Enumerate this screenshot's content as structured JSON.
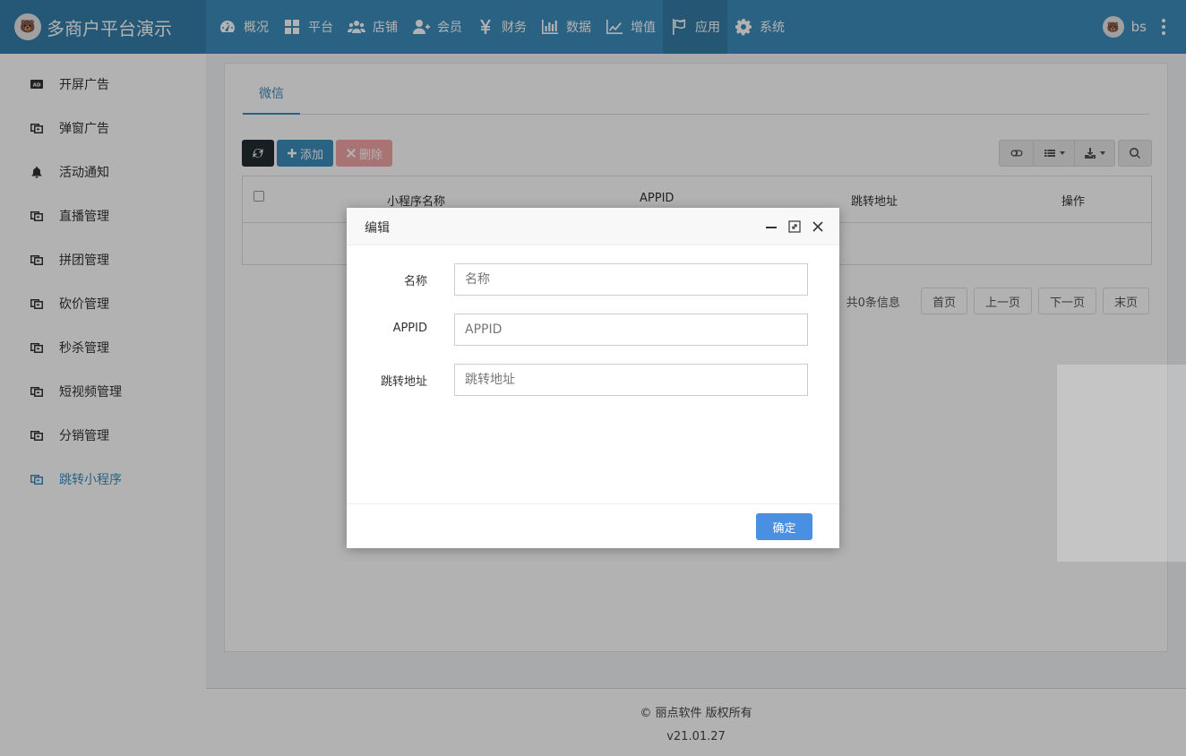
{
  "header": {
    "brand_name": "多商户平台演示",
    "logo_glyph": "🐻",
    "nav": [
      {
        "label": "概况",
        "icon": "dashboard-icon"
      },
      {
        "label": "平台",
        "icon": "grid-icon"
      },
      {
        "label": "店铺",
        "icon": "users-icon"
      },
      {
        "label": "会员",
        "icon": "user-plus-icon"
      },
      {
        "label": "财务",
        "icon": "yen-icon"
      },
      {
        "label": "数据",
        "icon": "bar-chart-icon"
      },
      {
        "label": "增值",
        "icon": "line-chart-icon"
      },
      {
        "label": "应用",
        "icon": "flag-icon"
      },
      {
        "label": "系统",
        "icon": "gear-icon"
      }
    ],
    "active_nav": "应用",
    "user_name": "bs"
  },
  "sidebar": {
    "items": [
      {
        "label": "开屏广告",
        "icon": "ad-icon"
      },
      {
        "label": "弹窗广告",
        "icon": "window-icon"
      },
      {
        "label": "活动通知",
        "icon": "bell-icon"
      },
      {
        "label": "直播管理",
        "icon": "window-icon"
      },
      {
        "label": "拼团管理",
        "icon": "window-icon"
      },
      {
        "label": "砍价管理",
        "icon": "window-icon"
      },
      {
        "label": "秒杀管理",
        "icon": "window-icon"
      },
      {
        "label": "短视频管理",
        "icon": "window-icon"
      },
      {
        "label": "分销管理",
        "icon": "window-icon"
      },
      {
        "label": "跳转小程序",
        "icon": "window-icon"
      }
    ],
    "active": "跳转小程序"
  },
  "main": {
    "tab": "微信",
    "toolbar": {
      "add": "添加",
      "delete": "删除"
    },
    "table": {
      "headers": [
        "小程序名称",
        "APPID",
        "跳转地址",
        "操作"
      ]
    },
    "pager": {
      "info": "共0条信息",
      "first": "首页",
      "prev": "上一页",
      "next": "下一页",
      "last": "末页"
    }
  },
  "footer": {
    "copyright": "© 丽点软件 版权所有",
    "version": "v21.01.27"
  },
  "modal": {
    "title": "编辑",
    "fields": [
      {
        "label": "名称",
        "placeholder": "名称",
        "value": ""
      },
      {
        "label": "APPID",
        "placeholder": "APPID",
        "value": ""
      },
      {
        "label": "跳转地址",
        "placeholder": "跳转地址",
        "value": ""
      }
    ],
    "confirm": "确定"
  }
}
